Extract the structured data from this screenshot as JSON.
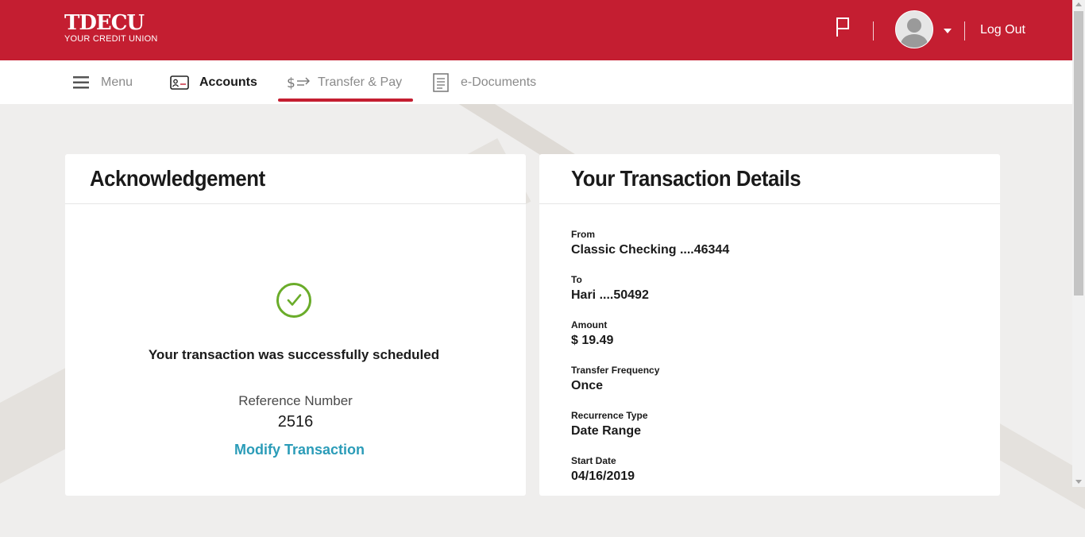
{
  "brand": {
    "name": "TDECU",
    "tagline": "YOUR CREDIT UNION",
    "primary_color": "#c41e31"
  },
  "header": {
    "logout_label": "Log Out"
  },
  "nav": {
    "menu_label": "Menu",
    "accounts_label": "Accounts",
    "transfer_label": "Transfer & Pay",
    "edocs_label": "e-Documents",
    "active": "Transfer & Pay"
  },
  "acknowledgement": {
    "title": "Acknowledgement",
    "message": "Your transaction was successfully scheduled",
    "reference_label": "Reference Number",
    "reference_value": "2516",
    "modify_label": "Modify Transaction"
  },
  "details": {
    "title": "Your Transaction Details",
    "items": [
      {
        "label": "From",
        "value": "Classic Checking ....46344"
      },
      {
        "label": "To",
        "value": "Hari ....50492"
      },
      {
        "label": "Amount",
        "value": "$ 19.49"
      },
      {
        "label": "Transfer Frequency",
        "value": "Once"
      },
      {
        "label": "Recurrence Type",
        "value": "Date Range"
      },
      {
        "label": "Start Date",
        "value": "04/16/2019"
      }
    ]
  }
}
